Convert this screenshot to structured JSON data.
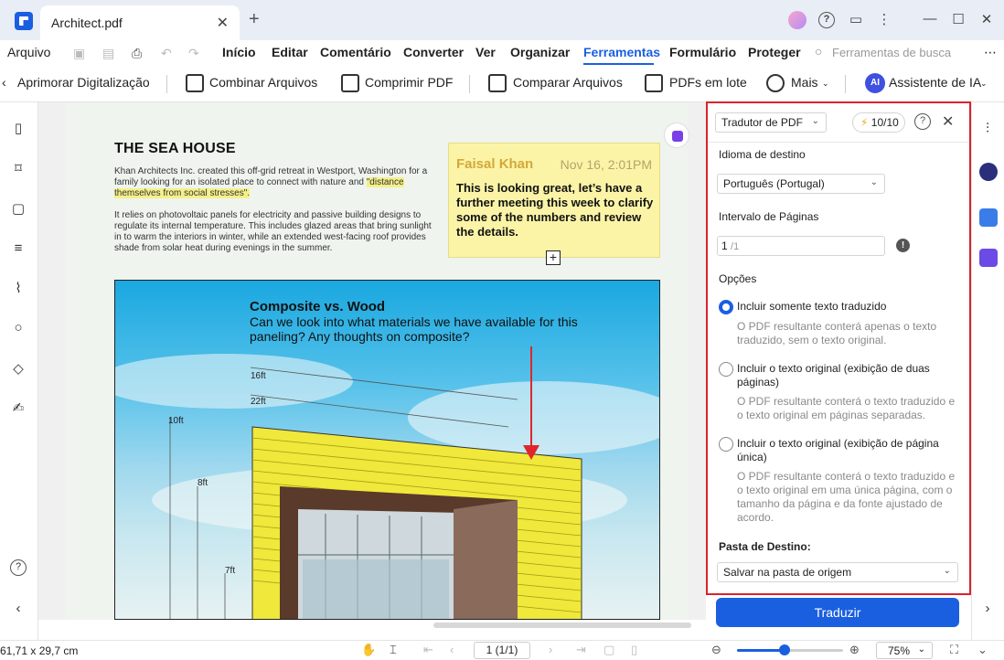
{
  "window": {
    "tab_title": "Architect.pdf",
    "tab_close": "✕",
    "tab_add": "+"
  },
  "menu": {
    "file": "Arquivo",
    "items": [
      "Início",
      "Editar",
      "Comentário",
      "Converter",
      "Ver",
      "Organizar",
      "Ferramentas",
      "Formulário",
      "Proteger"
    ],
    "active": "Ferramentas",
    "search_placeholder": "Ferramentas de busca",
    "more": "⋯"
  },
  "toolbar": {
    "enhance_scan": "Aprimorar Digitalização",
    "combine": "Combinar Arquivos",
    "compress": "Comprimir PDF",
    "compare": "Comparar Arquivos",
    "batch": "PDFs em lote",
    "more": "Mais",
    "ai_badge": "AI",
    "ai_assistant": "Assistente de IA"
  },
  "document": {
    "title": "THE SEA HOUSE",
    "para1_a": "Khan Architects Inc. created this off-grid retreat in Westport, Washington for a family looking for an isolated place to connect with nature and",
    "para1_hl": "\"distance themselves from social stresses\".",
    "para2": "It relies on photovoltaic panels for electricity and passive building designs to regulate its internal temperature. This includes glazed areas that bring sunlight in to warm the interiors in winter, while an extended west-facing roof provides shade from solar heat during evenings in the summer.",
    "sticky": {
      "author": "Faisal Khan",
      "date": "Nov 16, 2:01PM",
      "text": "This is looking great, let’s have a further meeting this week to clarify some of the numbers and review the details."
    },
    "image": {
      "annot_title": "Composite vs. Wood",
      "annot_text": "Can we look into what materials we have available for this paneling? Any thoughts on composite?",
      "dims": [
        "16ft",
        "22ft",
        "10ft",
        "8ft",
        "7ft"
      ]
    }
  },
  "panel": {
    "tool_select": "Tradutor de PDF",
    "credits": "10/10",
    "help": "?",
    "close": "✕",
    "target_lang_label": "Idioma de destino",
    "target_lang": "Português (Portugal)",
    "page_range_label": "Intervalo de Páginas",
    "page_from": "1",
    "page_total": "/1",
    "options_label": "Opções",
    "options": [
      {
        "label": "Incluir somente texto traduzido",
        "desc": "O PDF resultante conterá apenas o texto traduzido, sem o texto original.",
        "checked": true
      },
      {
        "label": "Incluir o texto original (exibição de duas páginas)",
        "desc": "O PDF resultante conterá o texto traduzido e o texto original em páginas separadas.",
        "checked": false
      },
      {
        "label": "Incluir o texto original (exibição de página única)",
        "desc": "O PDF resultante conterá o texto traduzido e o texto original em uma única página, com o tamanho da página e da fonte ajustado de acordo.",
        "checked": false
      }
    ],
    "dest_folder_label": "Pasta de Destino:",
    "dest_folder": "Salvar na pasta de origem",
    "translate_button": "Traduzir"
  },
  "status": {
    "dimensions": "61,71 x 29,7 cm",
    "page_indicator": "1 (1/1)",
    "zoom": "75%",
    "zoom_level": 0.45
  },
  "colors": {
    "accent": "#1a5fe0",
    "panel_highlight": "#d9232d",
    "sticky_bg": "#fbf4a7"
  }
}
